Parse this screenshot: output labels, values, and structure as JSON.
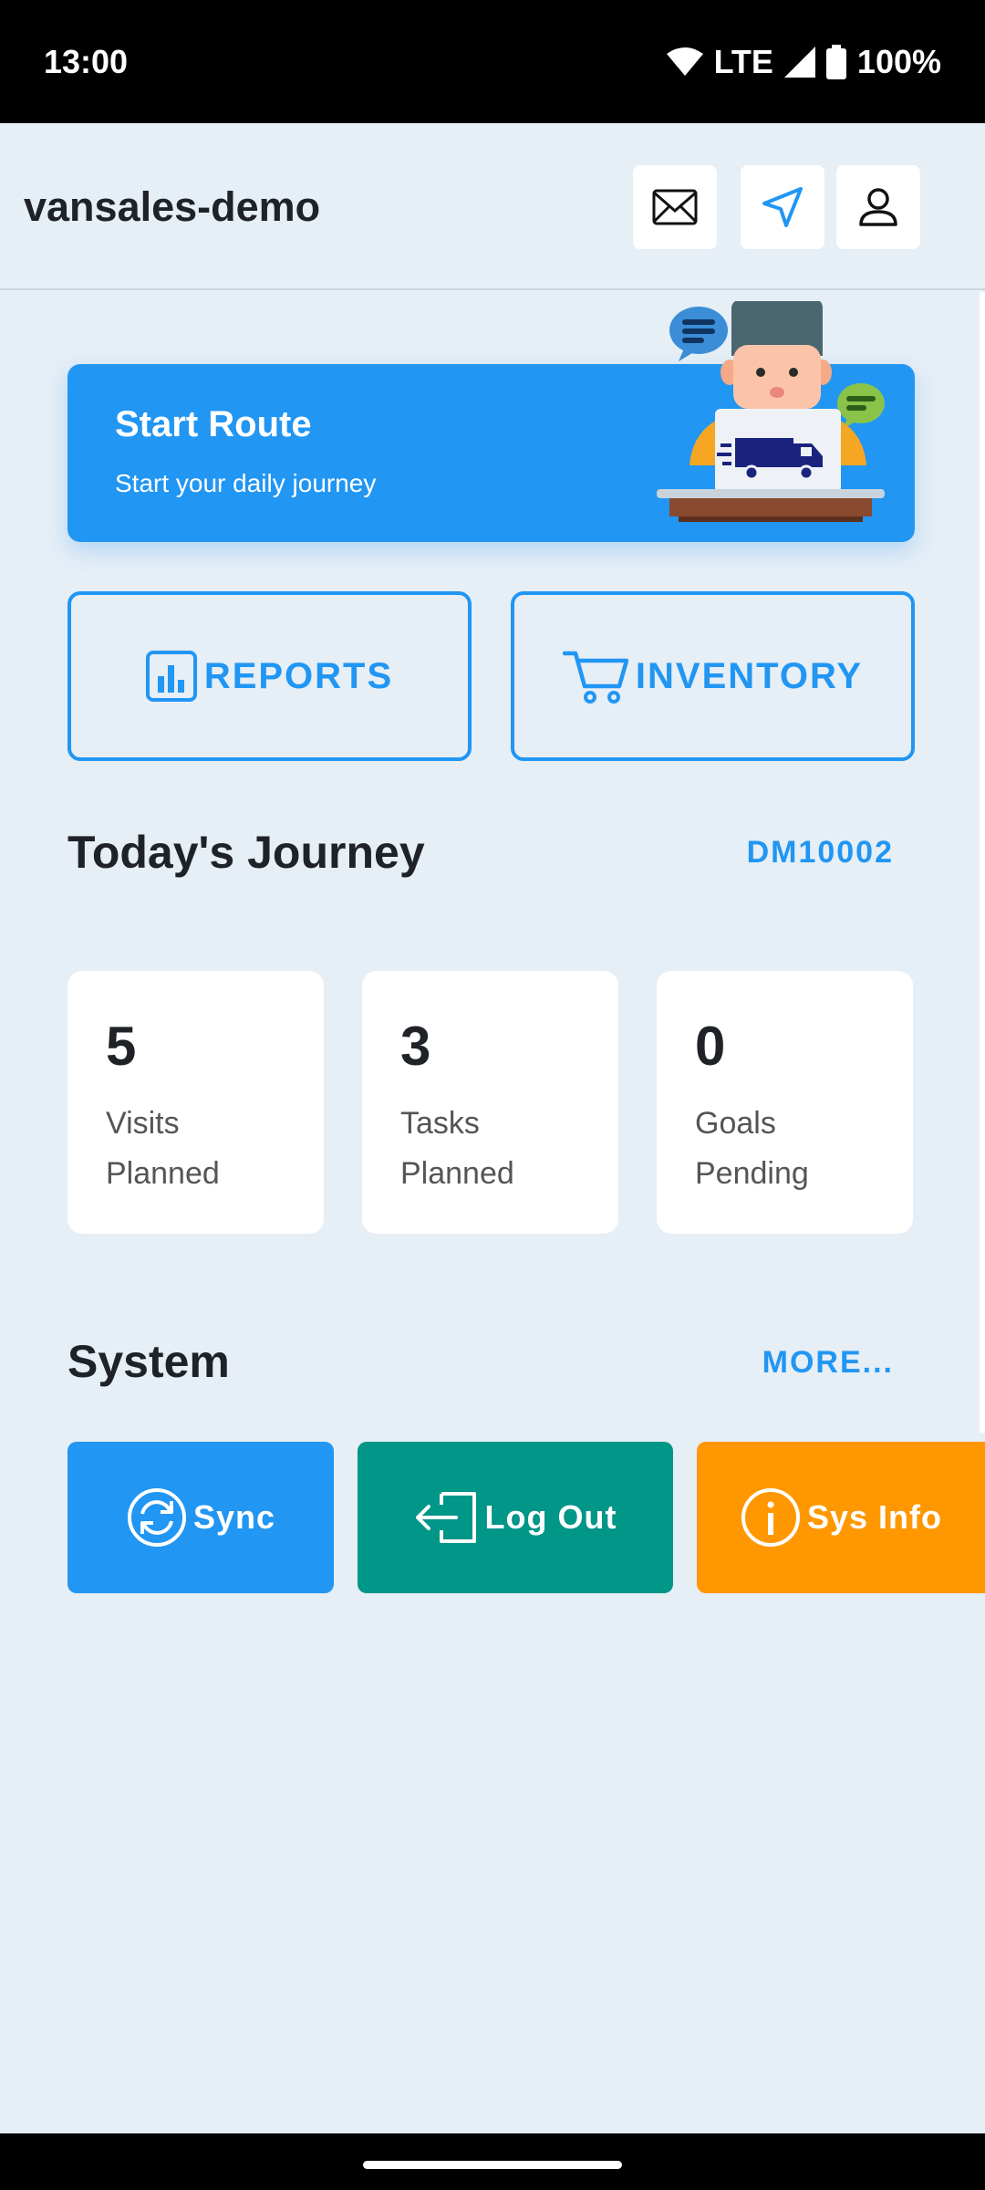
{
  "status_bar": {
    "time": "13:00",
    "network": "LTE",
    "battery": "100%"
  },
  "header": {
    "title": "vansales-demo",
    "icons": [
      "mail-icon",
      "navigation-arrow-icon",
      "user-icon"
    ]
  },
  "route_card": {
    "title": "Start Route",
    "subtitle": "Start your daily journey"
  },
  "actions": {
    "reports_label": "REPORTS",
    "inventory_label": "INVENTORY"
  },
  "journey": {
    "title": "Today's Journey",
    "code": "DM10002",
    "stats": [
      {
        "value": "5",
        "label": "Visits Planned"
      },
      {
        "value": "3",
        "label": "Tasks Planned"
      },
      {
        "value": "0",
        "label": "Goals Pending"
      }
    ]
  },
  "system": {
    "title": "System",
    "more_label": "MORE...",
    "buttons": [
      {
        "label": "Sync",
        "color": "#2196f3",
        "icon": "sync-icon"
      },
      {
        "label": "Log Out",
        "color": "#009688",
        "icon": "logout-icon"
      },
      {
        "label": "Sys Info",
        "color": "#ff9800",
        "icon": "info-icon"
      }
    ]
  },
  "colors": {
    "accent": "#2196f3",
    "background": "#e6eef6"
  }
}
